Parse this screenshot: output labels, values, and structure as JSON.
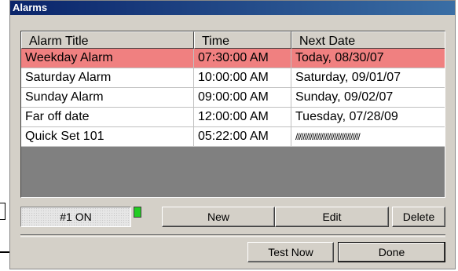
{
  "window": {
    "title": "Alarms"
  },
  "table": {
    "columns": [
      "Alarm Title",
      "Time",
      "Next Date"
    ],
    "rows": [
      {
        "title": "Weekday Alarm",
        "time": "07:30:00 AM",
        "next": "Today, 08/30/07",
        "selected": true
      },
      {
        "title": "Saturday Alarm",
        "time": "10:00:00 AM",
        "next": "Saturday, 09/01/07"
      },
      {
        "title": "Sunday Alarm",
        "time": "09:00:00 AM",
        "next": "Sunday, 09/02/07"
      },
      {
        "title": "Far off date",
        "time": "12:00:00 AM",
        "next": "Tuesday, 07/28/09"
      },
      {
        "title": "Quick Set 101",
        "time": "05:22:00 AM",
        "next": "///////////////////////////////////"
      }
    ],
    "selected_color": "#f08080"
  },
  "status": {
    "label": "#1 ON",
    "indicator_color": "#22cc22"
  },
  "buttons": {
    "new": "New",
    "edit": "Edit",
    "delete": "Delete",
    "test_now": "Test Now",
    "done": "Done"
  }
}
